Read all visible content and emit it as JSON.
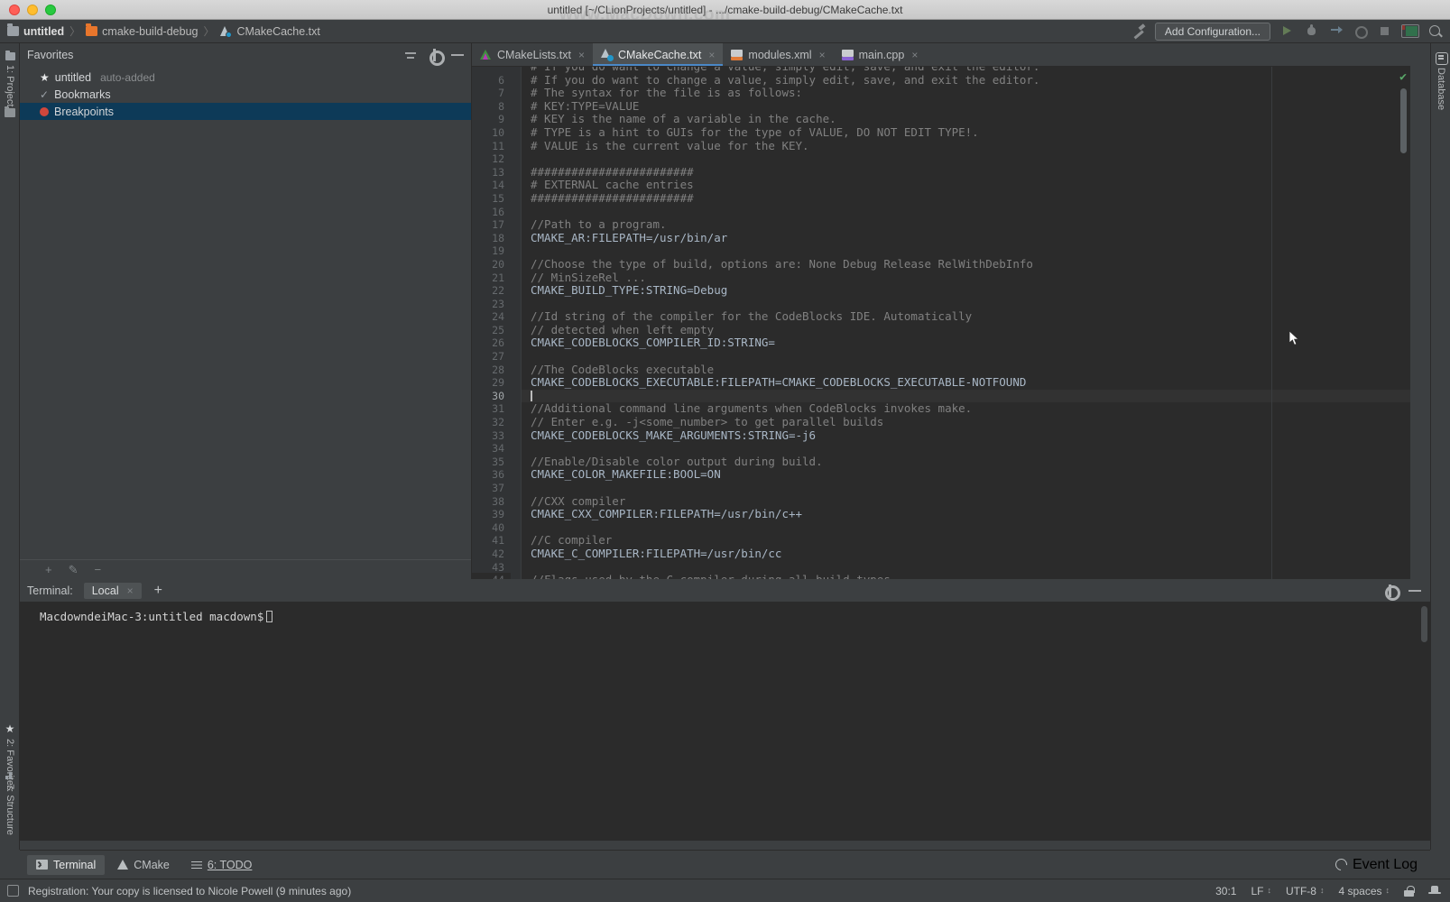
{
  "window": {
    "title": "untitled [~/CLionProjects/untitled] - .../cmake-build-debug/CMakeCache.txt",
    "watermark": "www.MacDown.com"
  },
  "breadcrumb": {
    "items": [
      {
        "label": "untitled",
        "icon": "folder-gray-icon"
      },
      {
        "label": "cmake-build-debug",
        "icon": "folder-orange-icon"
      },
      {
        "label": "CMakeCache.txt",
        "icon": "cmake-file-icon"
      }
    ],
    "separator": "〉"
  },
  "toolbar": {
    "build_icon": "hammer-icon",
    "add_configuration": "Add Configuration...",
    "run_icon": "run-icon",
    "debug_icon": "debug-icon",
    "step_icon": "step-over-icon",
    "attach_icon": "attach-to-process-icon",
    "stop_icon": "stop-icon",
    "layout_icon": "layout-icon",
    "search_icon": "search-everywhere-icon"
  },
  "left_strip": {
    "top": [
      {
        "label": "1: Project",
        "icon": "project-folder-icon"
      }
    ],
    "bottom": [
      {
        "label": "2: Favorites",
        "icon": "star-icon"
      },
      {
        "label": "7: Structure",
        "icon": "structure-icon"
      }
    ]
  },
  "right_strip": {
    "items": [
      {
        "label": "Database",
        "icon": "database-icon"
      }
    ]
  },
  "favorites": {
    "title": "Favorites",
    "actions": [
      {
        "name": "collapse-all",
        "icon": "collapse-all-icon"
      },
      {
        "name": "settings",
        "icon": "gear-icon"
      },
      {
        "name": "hide",
        "icon": "minimize-icon"
      }
    ],
    "rows": [
      {
        "label": "untitled",
        "sub": "auto-added",
        "icon": "star-icon",
        "selected": false
      },
      {
        "label": "Bookmarks",
        "sub": "",
        "icon": "check-icon",
        "selected": false
      },
      {
        "label": "Breakpoints",
        "sub": "",
        "icon": "breakpoint-icon",
        "selected": true
      }
    ],
    "bottom_actions": [
      {
        "name": "add",
        "glyph": "+"
      },
      {
        "name": "edit",
        "glyph": "✎"
      },
      {
        "name": "remove",
        "glyph": "−"
      }
    ]
  },
  "editor": {
    "tabs": [
      {
        "label": "CMakeLists.txt",
        "icon": "cmakelists-icon",
        "active": false
      },
      {
        "label": "CMakeCache.txt",
        "icon": "cmakecache-icon",
        "active": true
      },
      {
        "label": "modules.xml",
        "icon": "xml-file-icon",
        "active": false
      },
      {
        "label": "main.cpp",
        "icon": "cpp-file-icon",
        "active": false
      }
    ],
    "close_glyph": "×",
    "inspection_status": "✔",
    "caret_line": 30,
    "lines": [
      {
        "n": 5,
        "text": "# If you do want to change a value, simply edit, save, and exit the editor.",
        "type": "comment",
        "clipped_top": true
      },
      {
        "n": 6,
        "text": "# If you do want to change a value, simply edit, save, and exit the editor.",
        "type": "comment"
      },
      {
        "n": 7,
        "text": "# The syntax for the file is as follows:",
        "type": "comment"
      },
      {
        "n": 8,
        "text": "# KEY:TYPE=VALUE",
        "type": "comment"
      },
      {
        "n": 9,
        "text": "# KEY is the name of a variable in the cache.",
        "type": "comment"
      },
      {
        "n": 10,
        "text": "# TYPE is a hint to GUIs for the type of VALUE, DO NOT EDIT TYPE!.",
        "type": "comment"
      },
      {
        "n": 11,
        "text": "# VALUE is the current value for the KEY.",
        "type": "comment"
      },
      {
        "n": 12,
        "text": "",
        "type": "blank"
      },
      {
        "n": 13,
        "text": "########################",
        "type": "comment"
      },
      {
        "n": 14,
        "text": "# EXTERNAL cache entries",
        "type": "comment"
      },
      {
        "n": 15,
        "text": "########################",
        "type": "comment"
      },
      {
        "n": 16,
        "text": "",
        "type": "blank"
      },
      {
        "n": 17,
        "text": "//Path to a program.",
        "type": "comment"
      },
      {
        "n": 18,
        "text": "CMAKE_AR:FILEPATH=/usr/bin/ar",
        "type": "entry"
      },
      {
        "n": 19,
        "text": "",
        "type": "blank"
      },
      {
        "n": 20,
        "text": "//Choose the type of build, options are: None Debug Release RelWithDebInfo",
        "type": "comment"
      },
      {
        "n": 21,
        "text": "// MinSizeRel ...",
        "type": "comment"
      },
      {
        "n": 22,
        "text": "CMAKE_BUILD_TYPE:STRING=Debug",
        "type": "entry"
      },
      {
        "n": 23,
        "text": "",
        "type": "blank"
      },
      {
        "n": 24,
        "text": "//Id string of the compiler for the CodeBlocks IDE. Automatically",
        "type": "comment"
      },
      {
        "n": 25,
        "text": "// detected when left empty",
        "type": "comment"
      },
      {
        "n": 26,
        "text": "CMAKE_CODEBLOCKS_COMPILER_ID:STRING=",
        "type": "entry"
      },
      {
        "n": 27,
        "text": "",
        "type": "blank"
      },
      {
        "n": 28,
        "text": "//The CodeBlocks executable",
        "type": "comment"
      },
      {
        "n": 29,
        "text": "CMAKE_CODEBLOCKS_EXECUTABLE:FILEPATH=CMAKE_CODEBLOCKS_EXECUTABLE-NOTFOUND",
        "type": "entry"
      },
      {
        "n": 30,
        "text": "",
        "type": "caret"
      },
      {
        "n": 31,
        "text": "//Additional command line arguments when CodeBlocks invokes make.",
        "type": "comment"
      },
      {
        "n": 32,
        "text": "// Enter e.g. -j<some_number> to get parallel builds",
        "type": "comment"
      },
      {
        "n": 33,
        "text": "CMAKE_CODEBLOCKS_MAKE_ARGUMENTS:STRING=-j6",
        "type": "entry"
      },
      {
        "n": 34,
        "text": "",
        "type": "blank"
      },
      {
        "n": 35,
        "text": "//Enable/Disable color output during build.",
        "type": "comment"
      },
      {
        "n": 36,
        "text": "CMAKE_COLOR_MAKEFILE:BOOL=ON",
        "type": "entry"
      },
      {
        "n": 37,
        "text": "",
        "type": "blank"
      },
      {
        "n": 38,
        "text": "//CXX compiler",
        "type": "comment"
      },
      {
        "n": 39,
        "text": "CMAKE_CXX_COMPILER:FILEPATH=/usr/bin/c++",
        "type": "entry"
      },
      {
        "n": 40,
        "text": "",
        "type": "blank"
      },
      {
        "n": 41,
        "text": "//C compiler",
        "type": "comment"
      },
      {
        "n": 42,
        "text": "CMAKE_C_COMPILER:FILEPATH=/usr/bin/cc",
        "type": "entry"
      },
      {
        "n": 43,
        "text": "",
        "type": "blank"
      },
      {
        "n": 44,
        "text": "//Flags used by the C compiler during all build types.",
        "type": "comment",
        "clipped_bottom": true
      }
    ]
  },
  "terminal": {
    "label": "Terminal:",
    "tab": "Local",
    "close_glyph": "×",
    "new_tab_glyph": "+",
    "prompt": "MacdowndeiMac-3:untitled macdown$",
    "actions": [
      {
        "name": "settings",
        "icon": "gear-icon"
      },
      {
        "name": "hide",
        "icon": "minimize-icon"
      }
    ]
  },
  "bottom_tabs": {
    "items": [
      {
        "label": "Terminal",
        "icon": "terminal-icon",
        "active": true
      },
      {
        "label": "CMake",
        "icon": "cmake-icon",
        "active": false
      },
      {
        "label": "6: TODO",
        "icon": "todo-icon",
        "active": false
      }
    ],
    "event_log": "Event Log"
  },
  "statusbar": {
    "message": "Registration: Your copy is licensed to Nicole Powell (9 minutes ago)",
    "position": "30:1",
    "line_separator": "LF",
    "encoding": "UTF-8",
    "indent": "4 spaces",
    "chevron": "↕",
    "lock_icon": "read-only-lock-icon",
    "hat_icon": "power-save-hat-icon"
  },
  "colors": {
    "accent_blue": "#4a88c7",
    "selection_blue": "#0d3a58",
    "breakpoint_red": "#d0473c",
    "folder_orange": "#e8762c",
    "ok_green": "#59a869",
    "editor_bg": "#2b2b2b",
    "chrome_bg": "#3c3f41"
  }
}
